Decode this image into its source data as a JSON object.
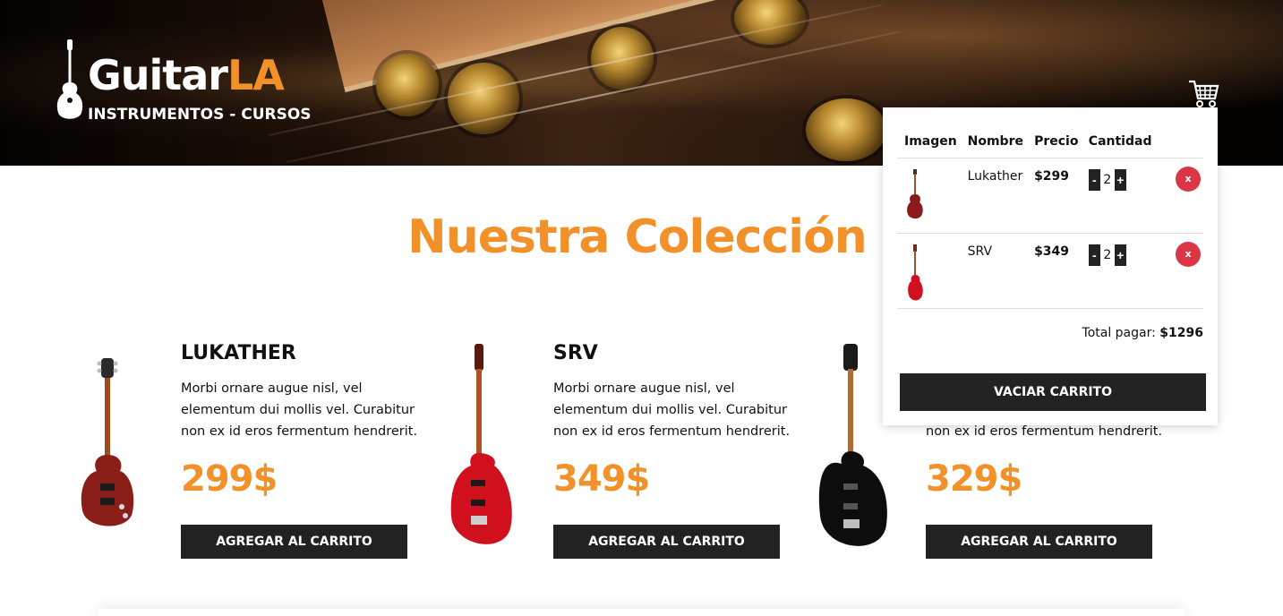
{
  "brand": {
    "name_main": "Guitar",
    "name_accent": "LA",
    "tagline": "INSTRUMENTOS - CURSOS"
  },
  "colors": {
    "accent": "#f2912a",
    "dark": "#222222",
    "danger": "#dc3545"
  },
  "header": {
    "cart_icon": "shopping-cart-icon"
  },
  "cart": {
    "columns": [
      "Imagen",
      "Nombre",
      "Precio",
      "Cantidad"
    ],
    "items": [
      {
        "name": "Lukather",
        "price": "$299",
        "quantity": "2",
        "decrement": "-",
        "increment": "+",
        "remove": "x"
      },
      {
        "name": "SRV",
        "price": "$349",
        "quantity": "2",
        "decrement": "-",
        "increment": "+",
        "remove": "x"
      }
    ],
    "total_label": "Total pagar: ",
    "total_value": "$1296",
    "empty_button": "VACIAR CARRITO"
  },
  "main": {
    "title": "Nuestra Colección",
    "products": [
      {
        "name": "LUKATHER",
        "description": "Morbi ornare augue nisl, vel elementum dui mollis vel. Curabitur non ex id eros fermentum hendrerit.",
        "price": "299$",
        "button": "AGREGAR AL CARRITO"
      },
      {
        "name": "SRV",
        "description": "Morbi ornare augue nisl, vel elementum dui mollis vel. Curabitur non ex id eros fermentum hendrerit.",
        "price": "349$",
        "button": "AGREGAR AL CARRITO"
      },
      {
        "name": "",
        "description_visible": "non ex id eros fermentum hendrerit.",
        "price": "329$",
        "button": "AGREGAR AL CARRITO"
      }
    ]
  }
}
